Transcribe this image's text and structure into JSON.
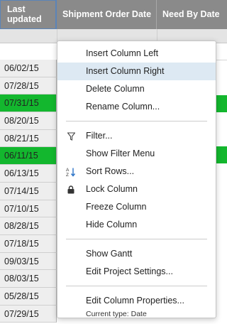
{
  "headers": [
    "Last updated",
    "Shipment Order Date",
    "Need By Date"
  ],
  "rows": [
    {
      "date": "06/02/15",
      "highlight": false
    },
    {
      "date": "07/28/15",
      "highlight": false
    },
    {
      "date": "07/31/15",
      "highlight": true
    },
    {
      "date": "08/20/15",
      "highlight": false
    },
    {
      "date": "08/21/15",
      "highlight": false
    },
    {
      "date": "06/11/15",
      "highlight": true
    },
    {
      "date": "06/13/15",
      "highlight": false
    },
    {
      "date": "07/14/15",
      "highlight": false
    },
    {
      "date": "07/10/15",
      "highlight": false
    },
    {
      "date": "08/28/15",
      "highlight": false
    },
    {
      "date": "07/18/15",
      "highlight": false
    },
    {
      "date": "09/03/15",
      "highlight": false
    },
    {
      "date": "08/03/15",
      "highlight": false
    },
    {
      "date": "05/28/15",
      "highlight": false
    },
    {
      "date": "07/29/15",
      "highlight": false
    }
  ],
  "highlight_color": "#13b72e",
  "menu": {
    "insert_left": "Insert Column Left",
    "insert_right": "Insert Column Right",
    "delete": "Delete Column",
    "rename": "Rename Column...",
    "filter": "Filter...",
    "show_filter_menu": "Show Filter Menu",
    "sort_rows": "Sort Rows...",
    "lock_column": "Lock Column",
    "freeze_column": "Freeze Column",
    "hide_column": "Hide Column",
    "show_gantt": "Show Gantt",
    "edit_project_settings": "Edit Project Settings...",
    "edit_column_properties": "Edit Column Properties...",
    "current_type": "Current type: Date"
  },
  "icons": {
    "filter": "filter-icon",
    "sort": "sort-az-icon",
    "lock": "lock-icon"
  }
}
